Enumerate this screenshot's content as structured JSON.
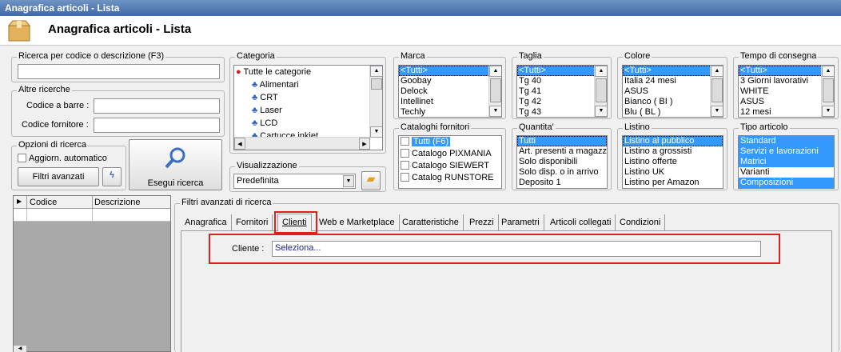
{
  "window": {
    "title": "Anagrafica articoli  - Lista"
  },
  "header": {
    "title": "Anagrafica articoli  - Lista"
  },
  "search": {
    "label": "Ricerca per codice o descrizione (F3)",
    "value": ""
  },
  "altre": {
    "label": "Altre ricerche",
    "barcode_label": "Codice a barre :",
    "supplier_label": "Codice fornitore :"
  },
  "options": {
    "label": "Opzioni di ricerca",
    "auto_update": "Aggiorn. automatico",
    "advanced_filters": "Filtri avanzati",
    "execute": "Esegui ricerca"
  },
  "category": {
    "label": "Categoria",
    "root": "Tutte le categorie",
    "items": [
      "Alimentari",
      "CRT",
      "Laser",
      "LCD",
      "Cartucce inkjet"
    ]
  },
  "visualizzazione": {
    "label": "Visualizzazione",
    "value": "Predefinita"
  },
  "marca": {
    "label": "Marca",
    "items": [
      "<Tutti>",
      "Goobay",
      "Delock",
      "Intellinet",
      "Techly"
    ]
  },
  "taglia": {
    "label": "Taglia",
    "items": [
      "<Tutti>",
      "Tg 40",
      "Tg 41",
      "Tg 42",
      "Tg 43"
    ]
  },
  "colore": {
    "label": "Colore",
    "items": [
      "<Tutti>",
      "Italia 24 mesi",
      "ASUS",
      "Bianco ( BI )",
      "Blu ( BL )"
    ]
  },
  "tempo": {
    "label": "Tempo di consegna",
    "items": [
      "<Tutti>",
      "3 Giorni lavorativi",
      "WHITE",
      "ASUS",
      "12 mesi"
    ]
  },
  "cataloghi": {
    "label": "Cataloghi fornitori",
    "items": [
      "Tutti (F6)",
      "Catalogo PIXMANIA",
      "Catalogo SIEWERT",
      "Catalog RUNSTORE"
    ]
  },
  "quantita": {
    "label": "Quantita'",
    "items": [
      "Tutti",
      "Art. presenti a magazzino",
      "Solo disponibili",
      "Solo disp. o in arrivo",
      "Deposito 1"
    ]
  },
  "listino": {
    "label": "Listino",
    "items": [
      "Listino al pubblico",
      "Listino a grossisti",
      "Listino offerte",
      "Listino UK",
      "Listino per Amazon"
    ]
  },
  "tipo": {
    "label": "Tipo articolo",
    "items": [
      "Standard",
      "Servizi e lavorazioni",
      "Matrici",
      "Varianti",
      "Composizioni"
    ]
  },
  "grid": {
    "col_code": "Codice",
    "col_desc": "Descrizione"
  },
  "filters": {
    "label": "Filtri avanzati di ricerca",
    "tabs": [
      "Anagrafica",
      "Fornitori",
      "Clienti",
      "Web e Marketplace",
      "Caratteristiche",
      "Prezzi",
      "Parametri",
      "Articoli collegati",
      "Condizioni"
    ],
    "client_label": "Cliente :",
    "client_value": "Seleziona..."
  },
  "colors": {
    "selection": "#3399ff",
    "highlight": "#e02020",
    "title_bar": "#4a74b0"
  }
}
